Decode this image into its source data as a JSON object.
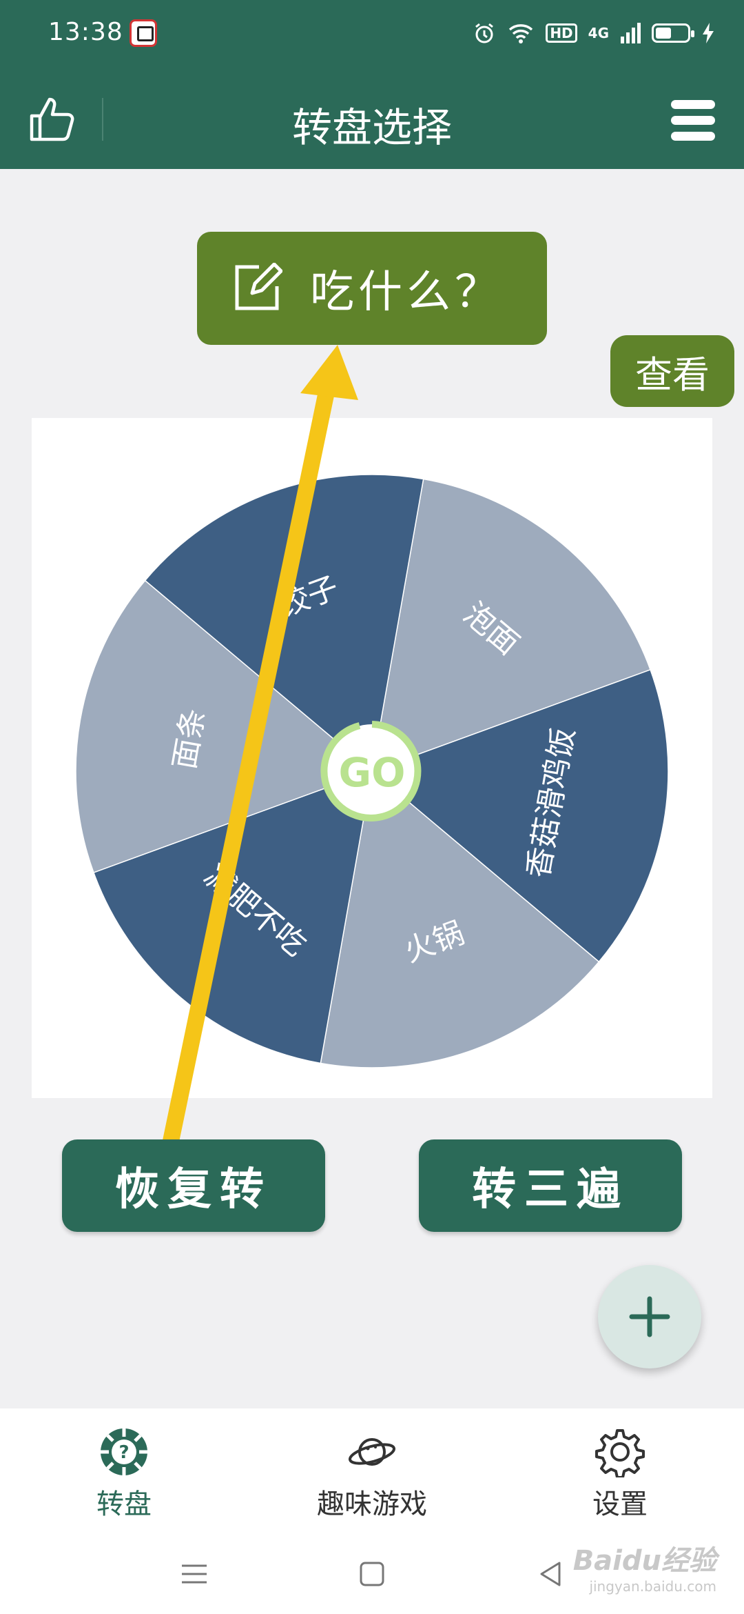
{
  "status_bar": {
    "time": "13:38",
    "hd": "HD",
    "network": "4G"
  },
  "app_bar": {
    "title": "转盘选择"
  },
  "wheel": {
    "title": "吃什么？",
    "view_label": "查看",
    "center_label": "GO",
    "segments": [
      {
        "label": "泡面",
        "color": "#9eabbd"
      },
      {
        "label": "香菇滑鸡饭",
        "color": "#3e5f84"
      },
      {
        "label": "火锅",
        "color": "#9eabbd"
      },
      {
        "label": "减肥不吃",
        "color": "#3e5f84"
      },
      {
        "label": "面条",
        "color": "#9eabbd"
      },
      {
        "label": "饺子",
        "color": "#3e5f84"
      }
    ],
    "center_ring_color": "#b9e28f"
  },
  "actions": {
    "restore_label": "恢复转",
    "spin_three_label": "转三遍"
  },
  "bottom_nav": [
    {
      "label": "转盘",
      "icon": "wheel-icon",
      "active": true
    },
    {
      "label": "趣味游戏",
      "icon": "planet-icon",
      "active": false
    },
    {
      "label": "设置",
      "icon": "gear-icon",
      "active": false
    }
  ],
  "watermark": {
    "brand": "Baidu经验",
    "url": "jingyan.baidu.com"
  },
  "colors": {
    "primary": "#2b6a58",
    "accent_green": "#5f832a",
    "arrow": "#f5c518"
  }
}
